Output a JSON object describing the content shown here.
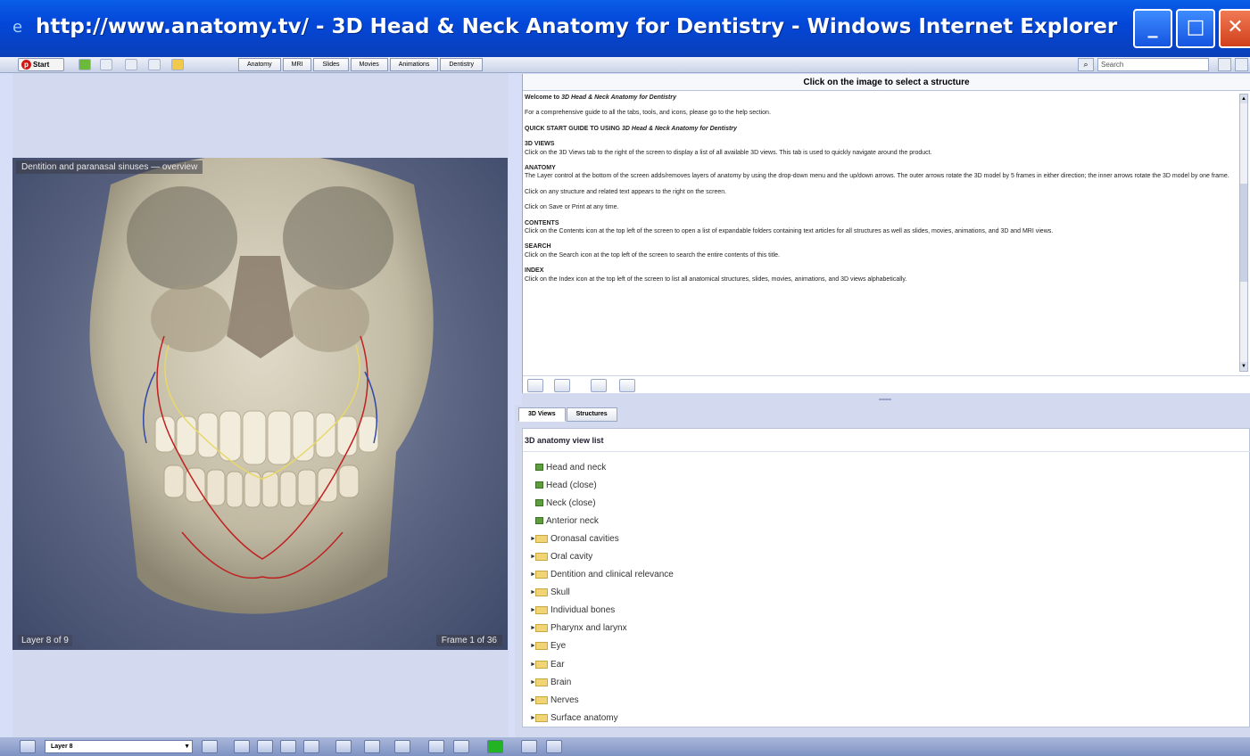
{
  "window": {
    "title": "http://www.anatomy.tv/ - 3D Head & Neck Anatomy for Dentistry - Windows Internet Explorer",
    "ie_icon": "e",
    "minimize": "_",
    "maximize": "□",
    "close": "✕"
  },
  "toolbar": {
    "start_label": "Start",
    "start_logo": "p",
    "tabs": [
      "Anatomy",
      "MRI",
      "Slides",
      "Movies",
      "Animations",
      "Dentistry"
    ],
    "search_placeholder": "Search",
    "search_icon": "⌕"
  },
  "viewer": {
    "title": "Dentition and paranasal sinuses — overview",
    "layer": "Layer 8 of 9",
    "frame": "Frame 1 of 36"
  },
  "info": {
    "header": "Click on the image to select a structure",
    "welcome_prefix": "Welcome to ",
    "welcome_product": "3D Head & Neck Anatomy for Dentistry",
    "intro": "For a comprehensive guide to all the tabs, tools, and icons, please go to the help section.",
    "quickstart_prefix": "QUICK START GUIDE TO USING ",
    "quickstart_product": "3D Head & Neck Anatomy for Dentistry",
    "sections": [
      {
        "heading": "3D VIEWS",
        "text": "Click on the 3D Views tab to the right of the screen to display a list of all available 3D views. This tab is used to quickly navigate around the product."
      },
      {
        "heading": "ANATOMY",
        "text": "The Layer control at the bottom of the screen adds/removes layers of anatomy by using the drop-down menu and the up/down arrows. The outer arrows rotate the 3D model by 5 frames in either direction; the inner arrows rotate the 3D model by one frame."
      },
      {
        "heading": "",
        "text": "Click on any structure and related text appears to the right on the screen."
      },
      {
        "heading": "",
        "text": "Click on Save or Print at any time."
      },
      {
        "heading": "CONTENTS",
        "text": "Click on the Contents icon at the top left of the screen to open a list of expandable folders containing text articles for all structures as well as slides, movies, animations, and 3D and MRI views."
      },
      {
        "heading": "SEARCH",
        "text": "Click on the Search icon at the top left of the screen to search the entire contents of this title."
      },
      {
        "heading": "INDEX",
        "text": "Click on the Index icon at the top left of the screen to list all anatomical structures, slides, movies, animations, and 3D views alphabetically."
      }
    ]
  },
  "tree": {
    "tabs": [
      "3D Views",
      "Structures"
    ],
    "title": "3D anatomy view list",
    "leaves": [
      "Head and neck",
      "Head (close)",
      "Neck (close)",
      "Anterior neck"
    ],
    "folders": [
      "Oronasal cavities",
      "Oral cavity",
      "Dentition and clinical relevance",
      "Skull",
      "Individual bones",
      "Pharynx and larynx",
      "Eye",
      "Ear",
      "Brain",
      "Nerves",
      "Surface anatomy"
    ]
  },
  "bottombar": {
    "layer_select_value": "Layer 8",
    "dropdown_icon": "▼"
  }
}
